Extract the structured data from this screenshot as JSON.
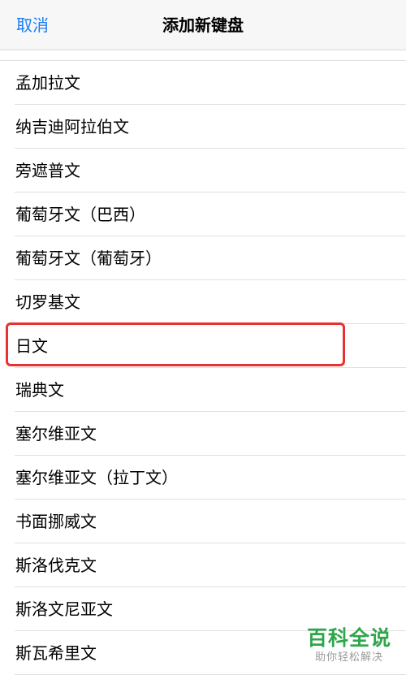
{
  "nav": {
    "cancel_label": "取消",
    "title": "添加新键盘"
  },
  "languages": [
    "孟加拉文",
    "纳吉迪阿拉伯文",
    "旁遮普文",
    "葡萄牙文（巴西）",
    "葡萄牙文（葡萄牙）",
    "切罗基文",
    "日文",
    "瑞典文",
    "塞尔维亚文",
    "塞尔维亚文（拉丁文）",
    "书面挪威文",
    "斯洛伐克文",
    "斯洛文尼亚文",
    "斯瓦希里文"
  ],
  "highlighted_item": "日文",
  "watermark": {
    "title": "百科全说",
    "subtitle": "助你轻松解决"
  },
  "colors": {
    "accent": "#1a7cf5",
    "highlight": "#e8322f",
    "watermark": "#2ea64a"
  }
}
